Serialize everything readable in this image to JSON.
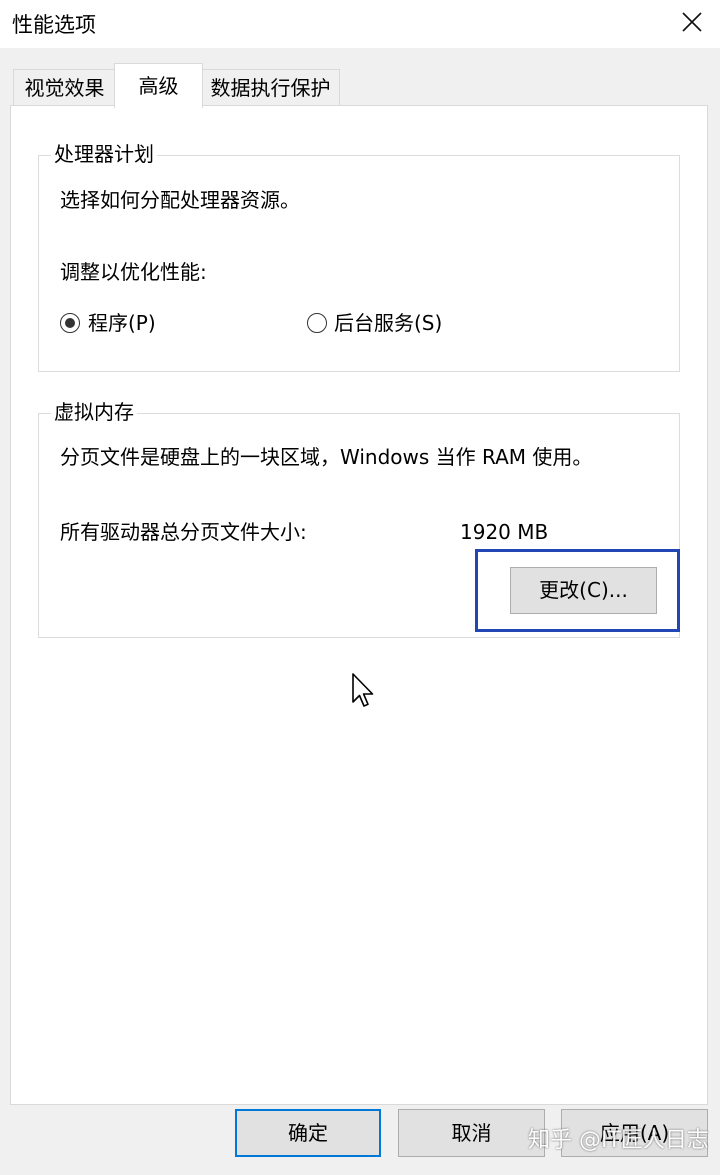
{
  "window": {
    "title": "性能选项"
  },
  "tabs": [
    {
      "label": "视觉效果"
    },
    {
      "label": "高级"
    },
    {
      "label": "数据执行保护"
    }
  ],
  "processor": {
    "group_title": "处理器计划",
    "description": "选择如何分配处理器资源。",
    "adjust_label": "调整以优化性能:",
    "options": [
      {
        "label": "程序(P)",
        "checked": true
      },
      {
        "label": "后台服务(S)",
        "checked": false
      }
    ]
  },
  "virtual_memory": {
    "group_title": "虚拟内存",
    "description": "分页文件是硬盘上的一块区域，Windows 当作 RAM 使用。",
    "total_label": "所有驱动器总分页文件大小:",
    "total_value": "1920 MB",
    "change_button": "更改(C)..."
  },
  "footer": {
    "ok": "确定",
    "cancel": "取消",
    "apply": "应用(A)"
  },
  "watermark": "知乎 @IT匠人日志",
  "colors": {
    "focus_frame": "#2346b5",
    "default_button_border": "#0078d7"
  },
  "icons": {
    "close": "close-icon",
    "cursor": "mouse-pointer-icon"
  }
}
